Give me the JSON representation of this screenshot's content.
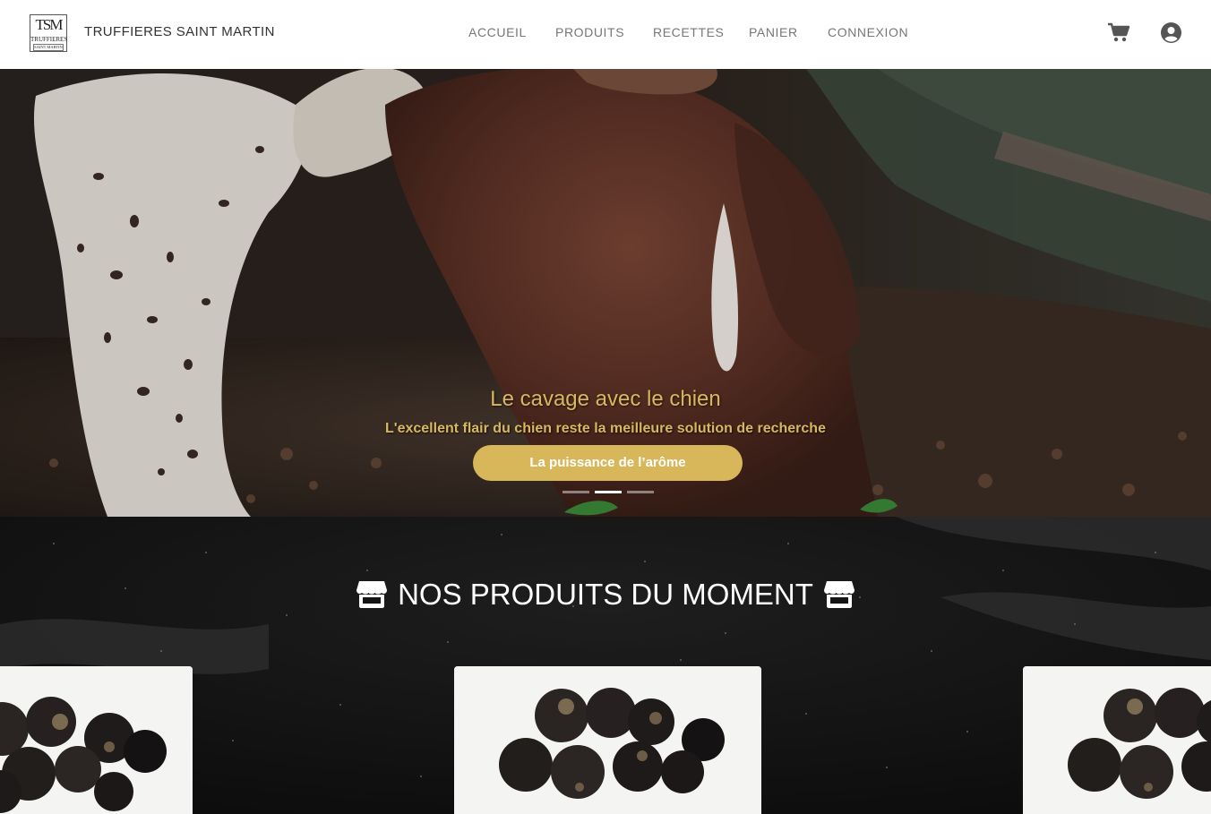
{
  "brand": {
    "logo_monogram": "TSM",
    "logo_line1": "TRUFFIERES",
    "logo_line2": "SAINT MARTIN",
    "name": "TRUFFIERES SAINT MARTIN"
  },
  "nav": {
    "items": [
      {
        "label": "ACCUEIL"
      },
      {
        "label": "PRODUITS"
      },
      {
        "label": "RECETTES"
      },
      {
        "label": "PANIER"
      },
      {
        "label": "CONNEXION"
      }
    ],
    "icons": [
      "cart-icon",
      "user-circle-icon"
    ]
  },
  "hero": {
    "title": "Le cavage avec le chien",
    "subtitle": "L'excellent flair du chien reste la meilleure solution de recherche",
    "button_label": "La puissance de l’arôme",
    "slides_count": 3,
    "active_slide": 2
  },
  "products": {
    "section_title": "NOS PRODUITS DU MOMENT",
    "section_icon": "store-icon",
    "cards": [
      {
        "image": "black-truffles-photo"
      },
      {
        "image": "black-truffles-photo"
      },
      {
        "image": "black-truffles-photo"
      }
    ]
  },
  "colors": {
    "accent_gold": "#d7b75a",
    "nav_text": "#777777",
    "section_bg": "#141414"
  }
}
